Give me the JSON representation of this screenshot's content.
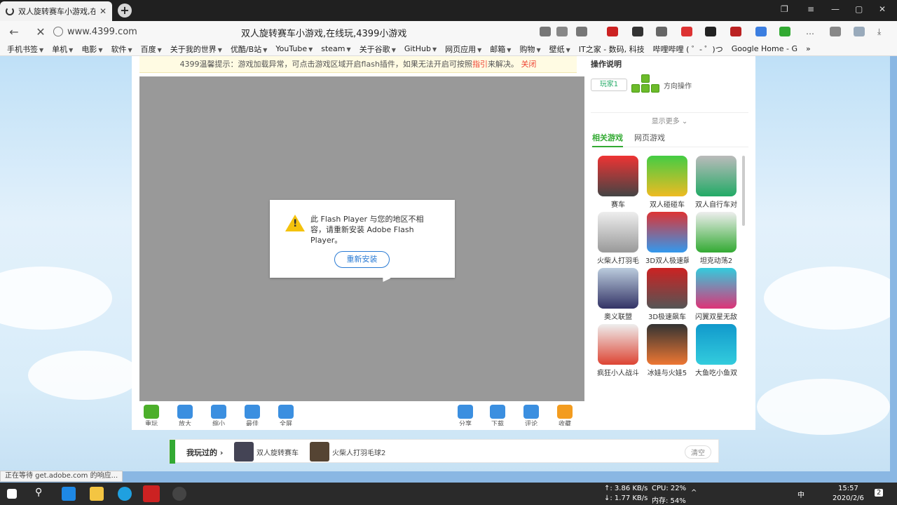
{
  "browser": {
    "tab_title": "双人旋转赛车小游戏,在",
    "url": "www.4399.com",
    "page_title": "双人旋转赛车小游戏,在线玩,4399小游戏"
  },
  "bookmarks": [
    "手机书签",
    "单机",
    "电影",
    "软件",
    "百度",
    "关于我的世界",
    "优酷/B站",
    "YouTube",
    "steam",
    "关于谷歌",
    "GitHub",
    "网页应用",
    "邮箱",
    "购物",
    "壁纸",
    "IT之家 - 数码, 科技",
    "哔哩哔哩 ( ゜- ゜)つ",
    "Google Home - G"
  ],
  "notice": {
    "prefix": "4399温馨提示：游戏加载异常，可点击游戏区域开启flash插件，如果无法开启可按照",
    "link": "指引",
    "suffix": "来解决。",
    "close": "关闭"
  },
  "flash_dialog": {
    "message": "此 Flash Player 与您的地区不相容，请重新安装 Adobe Flash Player。",
    "button": "重新安装"
  },
  "toolbar": {
    "refresh": "重玩",
    "zoom_in": "放大",
    "zoom_out": "缩小",
    "fit": "最佳",
    "fullscreen": "全屏",
    "share": "分享",
    "download": "下载",
    "comment": "评论",
    "favorite": "收藏"
  },
  "sidebar": {
    "instructions_title": "操作说明",
    "player_label": "玩家1",
    "direction_label": "方向操作",
    "show_more": "显示更多",
    "tab_related": "相关游戏",
    "tab_web": "网页游戏",
    "games": [
      "赛车",
      "双人碰碰车",
      "双人自行车对",
      "火柴人打羽毛",
      "3D双人极速飙",
      "坦克动荡2",
      "奥义联盟",
      "3D极速飙车",
      "闪翼双星无敌",
      "疯狂小人战斗",
      "冰娃与火娃5",
      "大鱼吃小鱼双"
    ]
  },
  "played": {
    "label": "我玩过的",
    "items": [
      "双人旋转赛车",
      "火柴人打羽毛球2"
    ],
    "clear": "清空"
  },
  "status_text": "正在等待 get.adobe.com 的响应...",
  "taskbar": {
    "net_up": "↑: 3.86 KB/s",
    "net_down": "↓: 1.77 KB/s",
    "cpu": "CPU: 22%",
    "mem": "内存: 54%",
    "ime": "中",
    "time": "15:57",
    "date": "2020/2/6",
    "notif_count": "2"
  }
}
